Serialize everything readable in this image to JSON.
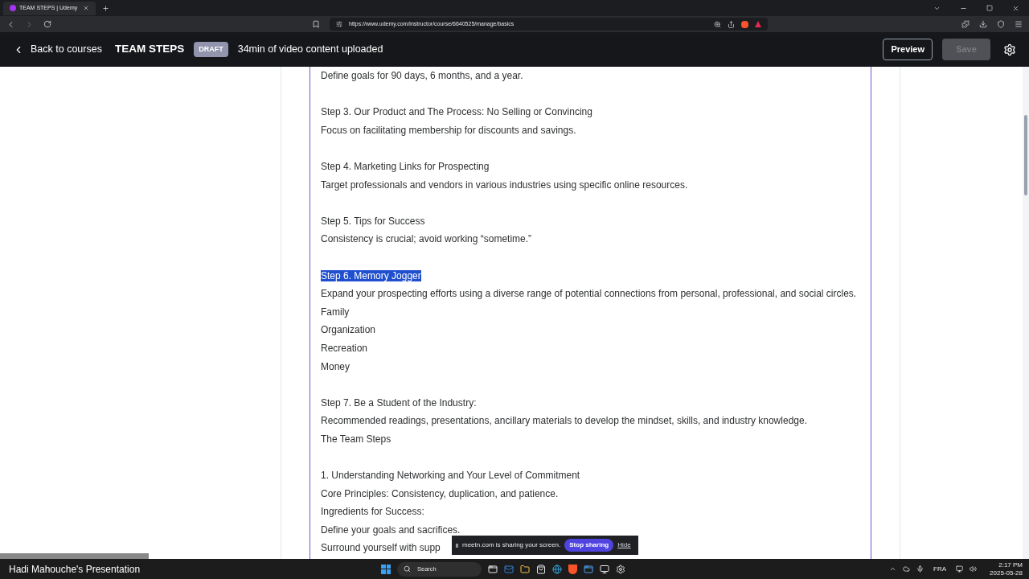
{
  "browser": {
    "tab": {
      "title": "TEAM STEPS | Udemy",
      "selected": true
    },
    "url": "https://www.udemy.com/instructor/course/6640525/manage/basics"
  },
  "header": {
    "back": "Back to courses",
    "title": "TEAM STEPS",
    "badge": "DRAFT",
    "status": "34min of video content uploaded",
    "preview": "Preview",
    "save": {
      "label": "Save",
      "disabled": true
    }
  },
  "editor": {
    "lines": [
      {
        "kind": "line",
        "text": "Define goals for 90 days, 6 months, and a year.",
        "highlighted": false
      },
      {
        "kind": "gap"
      },
      {
        "kind": "line",
        "text": "Step 3. Our Product and The Process: No Selling or Convincing",
        "highlighted": false
      },
      {
        "kind": "line",
        "text": "Focus on facilitating membership for discounts and savings.",
        "highlighted": false
      },
      {
        "kind": "gap"
      },
      {
        "kind": "line",
        "text": "Step 4. Marketing Links for Prospecting",
        "highlighted": false
      },
      {
        "kind": "line",
        "text": "Target professionals and vendors in various industries using specific online resources.",
        "highlighted": false
      },
      {
        "kind": "gap"
      },
      {
        "kind": "line",
        "text": "Step 5. Tips for Success",
        "highlighted": false
      },
      {
        "kind": "line",
        "text": "Consistency is crucial; avoid working “sometime.”",
        "highlighted": false
      },
      {
        "kind": "gap"
      },
      {
        "kind": "line",
        "text": "Step 6. Memory Jogger",
        "highlighted": true
      },
      {
        "kind": "line",
        "text": "Expand your prospecting efforts using a diverse range of potential connections from personal, professional, and social circles.",
        "highlighted": false
      },
      {
        "kind": "line",
        "text": "Family",
        "highlighted": false
      },
      {
        "kind": "line",
        "text": "Organization",
        "highlighted": false
      },
      {
        "kind": "line",
        "text": "Recreation",
        "highlighted": false
      },
      {
        "kind": "line",
        "text": "Money",
        "highlighted": false
      },
      {
        "kind": "gap"
      },
      {
        "kind": "line",
        "text": "Step 7. Be a Student of the Industry:",
        "highlighted": false
      },
      {
        "kind": "line",
        "text": "Recommended readings, presentations, ancillary materials to develop the mindset, skills, and industry knowledge.",
        "highlighted": false
      },
      {
        "kind": "line",
        "text": "The Team Steps",
        "highlighted": false
      },
      {
        "kind": "gap"
      },
      {
        "kind": "line",
        "text": "1. Understanding Networking and Your Level of Commitment",
        "highlighted": false
      },
      {
        "kind": "line",
        "text": "Core Principles: Consistency, duplication, and patience.",
        "highlighted": false
      },
      {
        "kind": "line",
        "text": "Ingredients for Success:",
        "highlighted": false
      },
      {
        "kind": "line",
        "text": "Define your goals and sacrifices.",
        "highlighted": false
      },
      {
        "kind": "line",
        "text": "Surround yourself with supp",
        "highlighted": false
      }
    ]
  },
  "presenter_label": "Hadi Mahouche's Presentation",
  "share_bar": {
    "message": "meetn.com is sharing your screen.",
    "stop": "Stop sharing",
    "hide": "Hide"
  },
  "taskbar": {
    "search": "Search",
    "language": "FRA",
    "time": "2:17 PM",
    "date": "2025-05-28"
  }
}
